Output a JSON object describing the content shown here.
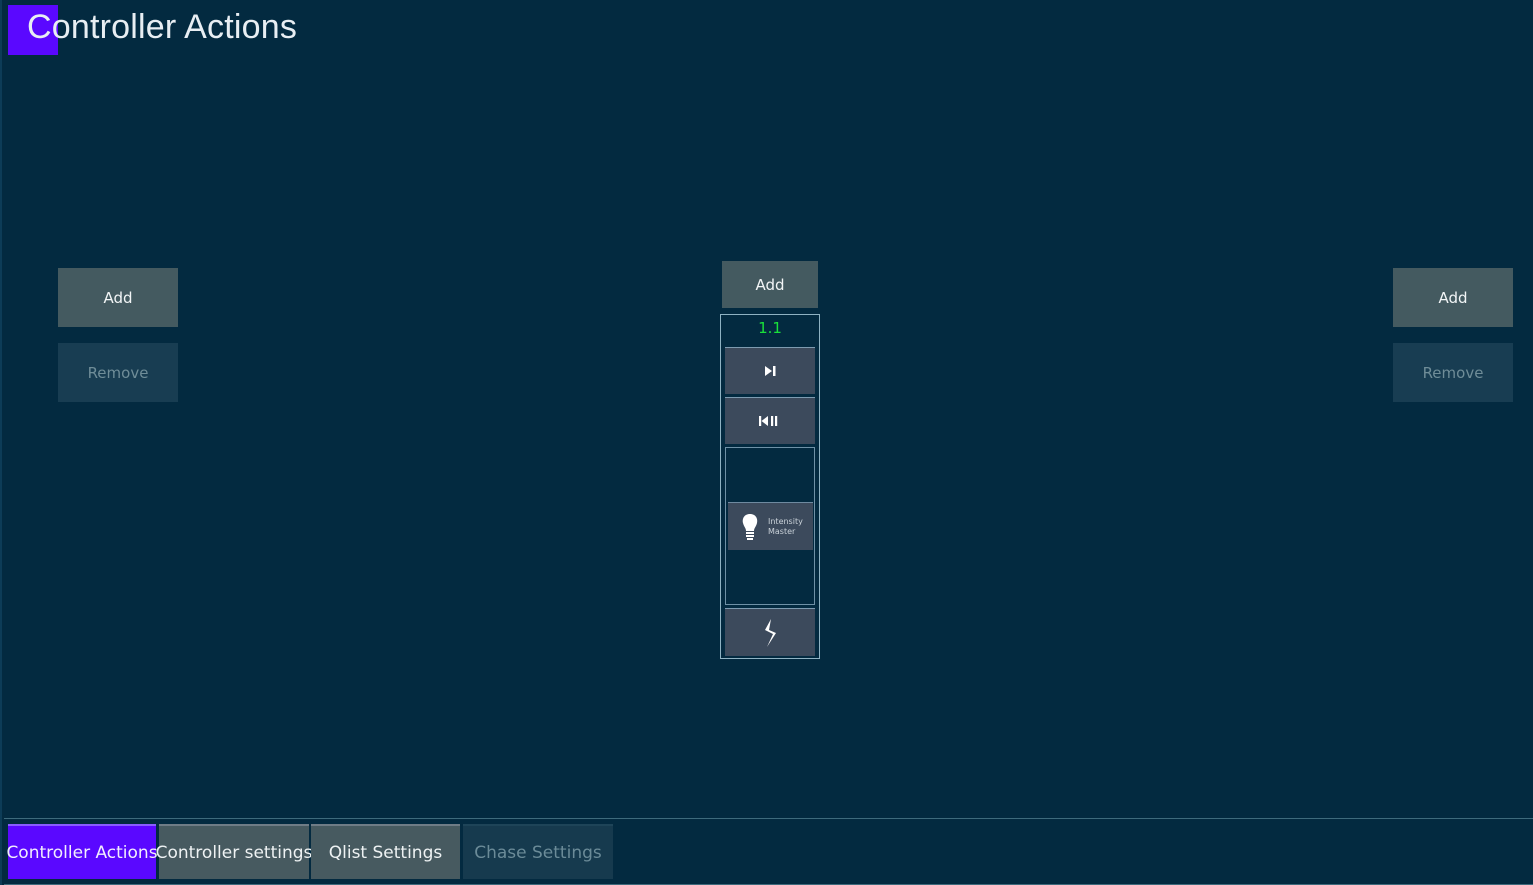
{
  "page": {
    "title": "Controller Actions",
    "accent_color": "#5a08ff",
    "background_color": "#032a40"
  },
  "left_panel": {
    "add_label": "Add",
    "remove_label": "Remove"
  },
  "center_panel": {
    "add_label": "Add",
    "fader": {
      "cue_number": "1.1",
      "cue_color": "#19e03a",
      "go_button_icon": "go-icon",
      "back_button_icon": "back-pause-icon",
      "intensity_button": {
        "icon": "lightbulb-icon",
        "label_line1": "Intensity",
        "label_line2": "Master"
      },
      "chase_button_icon": "chase-icon"
    }
  },
  "right_panel": {
    "add_label": "Add",
    "remove_label": "Remove"
  },
  "tabs": [
    {
      "label": "Controller Actions",
      "state": "active"
    },
    {
      "label": "Controller settings",
      "state": "normal"
    },
    {
      "label": "Qlist Settings",
      "state": "normal"
    },
    {
      "label": "Chase Settings",
      "state": "disabled"
    }
  ]
}
